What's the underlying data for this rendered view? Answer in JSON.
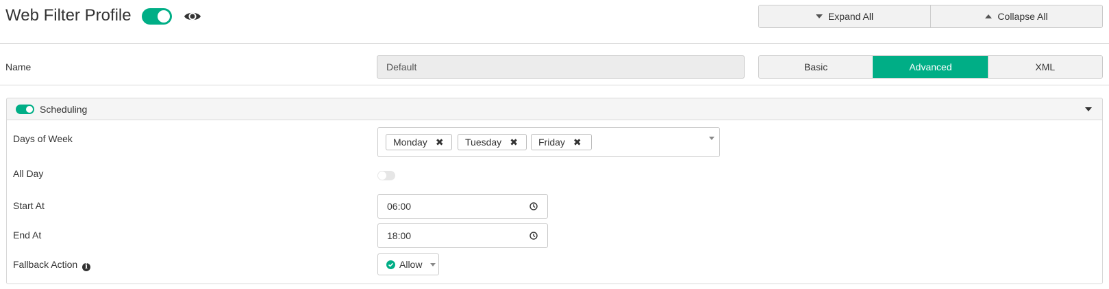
{
  "header": {
    "title": "Web Filter Profile",
    "expand_all": "Expand All",
    "collapse_all": "Collapse All"
  },
  "name_row": {
    "label": "Name",
    "value": "Default",
    "modes": [
      "Basic",
      "Advanced",
      "XML"
    ],
    "active_mode": "Advanced"
  },
  "scheduling": {
    "title": "Scheduling",
    "enabled": true,
    "days_label": "Days of Week",
    "days": [
      "Monday",
      "Tuesday",
      "Friday"
    ],
    "all_day_label": "All Day",
    "all_day": false,
    "start_label": "Start At",
    "start_value": "06:00",
    "end_label": "End At",
    "end_value": "18:00",
    "fallback_label": "Fallback Action",
    "fallback_value": "Allow"
  },
  "colors": {
    "accent": "#00ae86",
    "border": "#c9c9c9",
    "panel_header": "#f5f5f5"
  },
  "icons": [
    "eye-icon",
    "chevron-down-icon",
    "chevron-up-icon",
    "remove-icon",
    "clock-icon",
    "check-circle-icon",
    "info-icon"
  ]
}
